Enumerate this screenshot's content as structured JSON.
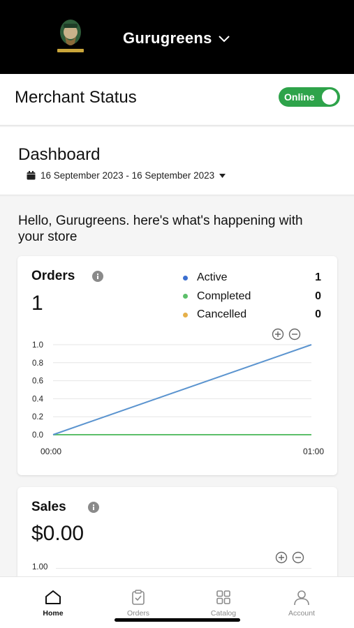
{
  "header": {
    "store_name": "Gurugreens",
    "logo_text": "GURUGREENS"
  },
  "merchant": {
    "title": "Merchant Status",
    "status_label": "Online",
    "status_on": true
  },
  "dashboard": {
    "title": "Dashboard",
    "date_range": "16 September 2023 - 16 September 2023"
  },
  "greeting": "Hello, Gurugreens. here's what's happening with your store",
  "orders": {
    "title": "Orders",
    "total": "1",
    "legend": [
      {
        "name": "Active",
        "value": "1",
        "color": "#3b6fd0"
      },
      {
        "name": "Completed",
        "value": "0",
        "color": "#5cbf6a"
      },
      {
        "name": "Cancelled",
        "value": "0",
        "color": "#e6b04a"
      }
    ]
  },
  "chart_data": {
    "type": "line",
    "x": [
      "00:00",
      "01:00"
    ],
    "yticks": [
      "0.0",
      "0.2",
      "0.4",
      "0.6",
      "0.8",
      "1.0"
    ],
    "ylim": [
      0,
      1
    ],
    "series": [
      {
        "name": "Active",
        "values": [
          0,
          1
        ],
        "color": "#5b94cf"
      },
      {
        "name": "Completed",
        "values": [
          0,
          0
        ],
        "color": "#5cbf6a"
      },
      {
        "name": "Cancelled",
        "values": [
          0,
          0
        ],
        "color": "#d8bd55"
      }
    ],
    "grid": true
  },
  "sales": {
    "title": "Sales",
    "total": "$0.00",
    "first_tick": "1.00"
  },
  "tabs": [
    {
      "label": "Home",
      "icon": "home-icon",
      "active": true
    },
    {
      "label": "Orders",
      "icon": "clipboard-icon",
      "active": false
    },
    {
      "label": "Catalog",
      "icon": "grid-icon",
      "active": false
    },
    {
      "label": "Account",
      "icon": "user-icon",
      "active": false
    }
  ]
}
